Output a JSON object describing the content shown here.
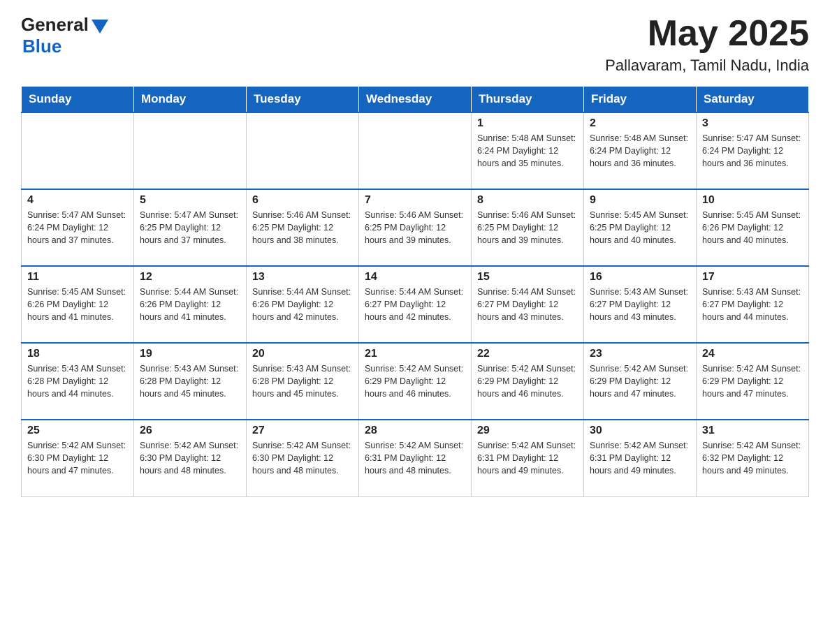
{
  "logo": {
    "general": "General",
    "blue": "Blue"
  },
  "header": {
    "month": "May 2025",
    "location": "Pallavaram, Tamil Nadu, India"
  },
  "weekdays": [
    "Sunday",
    "Monday",
    "Tuesday",
    "Wednesday",
    "Thursday",
    "Friday",
    "Saturday"
  ],
  "weeks": [
    [
      {
        "day": "",
        "info": ""
      },
      {
        "day": "",
        "info": ""
      },
      {
        "day": "",
        "info": ""
      },
      {
        "day": "",
        "info": ""
      },
      {
        "day": "1",
        "info": "Sunrise: 5:48 AM\nSunset: 6:24 PM\nDaylight: 12 hours and 35 minutes."
      },
      {
        "day": "2",
        "info": "Sunrise: 5:48 AM\nSunset: 6:24 PM\nDaylight: 12 hours and 36 minutes."
      },
      {
        "day": "3",
        "info": "Sunrise: 5:47 AM\nSunset: 6:24 PM\nDaylight: 12 hours and 36 minutes."
      }
    ],
    [
      {
        "day": "4",
        "info": "Sunrise: 5:47 AM\nSunset: 6:24 PM\nDaylight: 12 hours and 37 minutes."
      },
      {
        "day": "5",
        "info": "Sunrise: 5:47 AM\nSunset: 6:25 PM\nDaylight: 12 hours and 37 minutes."
      },
      {
        "day": "6",
        "info": "Sunrise: 5:46 AM\nSunset: 6:25 PM\nDaylight: 12 hours and 38 minutes."
      },
      {
        "day": "7",
        "info": "Sunrise: 5:46 AM\nSunset: 6:25 PM\nDaylight: 12 hours and 39 minutes."
      },
      {
        "day": "8",
        "info": "Sunrise: 5:46 AM\nSunset: 6:25 PM\nDaylight: 12 hours and 39 minutes."
      },
      {
        "day": "9",
        "info": "Sunrise: 5:45 AM\nSunset: 6:25 PM\nDaylight: 12 hours and 40 minutes."
      },
      {
        "day": "10",
        "info": "Sunrise: 5:45 AM\nSunset: 6:26 PM\nDaylight: 12 hours and 40 minutes."
      }
    ],
    [
      {
        "day": "11",
        "info": "Sunrise: 5:45 AM\nSunset: 6:26 PM\nDaylight: 12 hours and 41 minutes."
      },
      {
        "day": "12",
        "info": "Sunrise: 5:44 AM\nSunset: 6:26 PM\nDaylight: 12 hours and 41 minutes."
      },
      {
        "day": "13",
        "info": "Sunrise: 5:44 AM\nSunset: 6:26 PM\nDaylight: 12 hours and 42 minutes."
      },
      {
        "day": "14",
        "info": "Sunrise: 5:44 AM\nSunset: 6:27 PM\nDaylight: 12 hours and 42 minutes."
      },
      {
        "day": "15",
        "info": "Sunrise: 5:44 AM\nSunset: 6:27 PM\nDaylight: 12 hours and 43 minutes."
      },
      {
        "day": "16",
        "info": "Sunrise: 5:43 AM\nSunset: 6:27 PM\nDaylight: 12 hours and 43 minutes."
      },
      {
        "day": "17",
        "info": "Sunrise: 5:43 AM\nSunset: 6:27 PM\nDaylight: 12 hours and 44 minutes."
      }
    ],
    [
      {
        "day": "18",
        "info": "Sunrise: 5:43 AM\nSunset: 6:28 PM\nDaylight: 12 hours and 44 minutes."
      },
      {
        "day": "19",
        "info": "Sunrise: 5:43 AM\nSunset: 6:28 PM\nDaylight: 12 hours and 45 minutes."
      },
      {
        "day": "20",
        "info": "Sunrise: 5:43 AM\nSunset: 6:28 PM\nDaylight: 12 hours and 45 minutes."
      },
      {
        "day": "21",
        "info": "Sunrise: 5:42 AM\nSunset: 6:29 PM\nDaylight: 12 hours and 46 minutes."
      },
      {
        "day": "22",
        "info": "Sunrise: 5:42 AM\nSunset: 6:29 PM\nDaylight: 12 hours and 46 minutes."
      },
      {
        "day": "23",
        "info": "Sunrise: 5:42 AM\nSunset: 6:29 PM\nDaylight: 12 hours and 47 minutes."
      },
      {
        "day": "24",
        "info": "Sunrise: 5:42 AM\nSunset: 6:29 PM\nDaylight: 12 hours and 47 minutes."
      }
    ],
    [
      {
        "day": "25",
        "info": "Sunrise: 5:42 AM\nSunset: 6:30 PM\nDaylight: 12 hours and 47 minutes."
      },
      {
        "day": "26",
        "info": "Sunrise: 5:42 AM\nSunset: 6:30 PM\nDaylight: 12 hours and 48 minutes."
      },
      {
        "day": "27",
        "info": "Sunrise: 5:42 AM\nSunset: 6:30 PM\nDaylight: 12 hours and 48 minutes."
      },
      {
        "day": "28",
        "info": "Sunrise: 5:42 AM\nSunset: 6:31 PM\nDaylight: 12 hours and 48 minutes."
      },
      {
        "day": "29",
        "info": "Sunrise: 5:42 AM\nSunset: 6:31 PM\nDaylight: 12 hours and 49 minutes."
      },
      {
        "day": "30",
        "info": "Sunrise: 5:42 AM\nSunset: 6:31 PM\nDaylight: 12 hours and 49 minutes."
      },
      {
        "day": "31",
        "info": "Sunrise: 5:42 AM\nSunset: 6:32 PM\nDaylight: 12 hours and 49 minutes."
      }
    ]
  ]
}
